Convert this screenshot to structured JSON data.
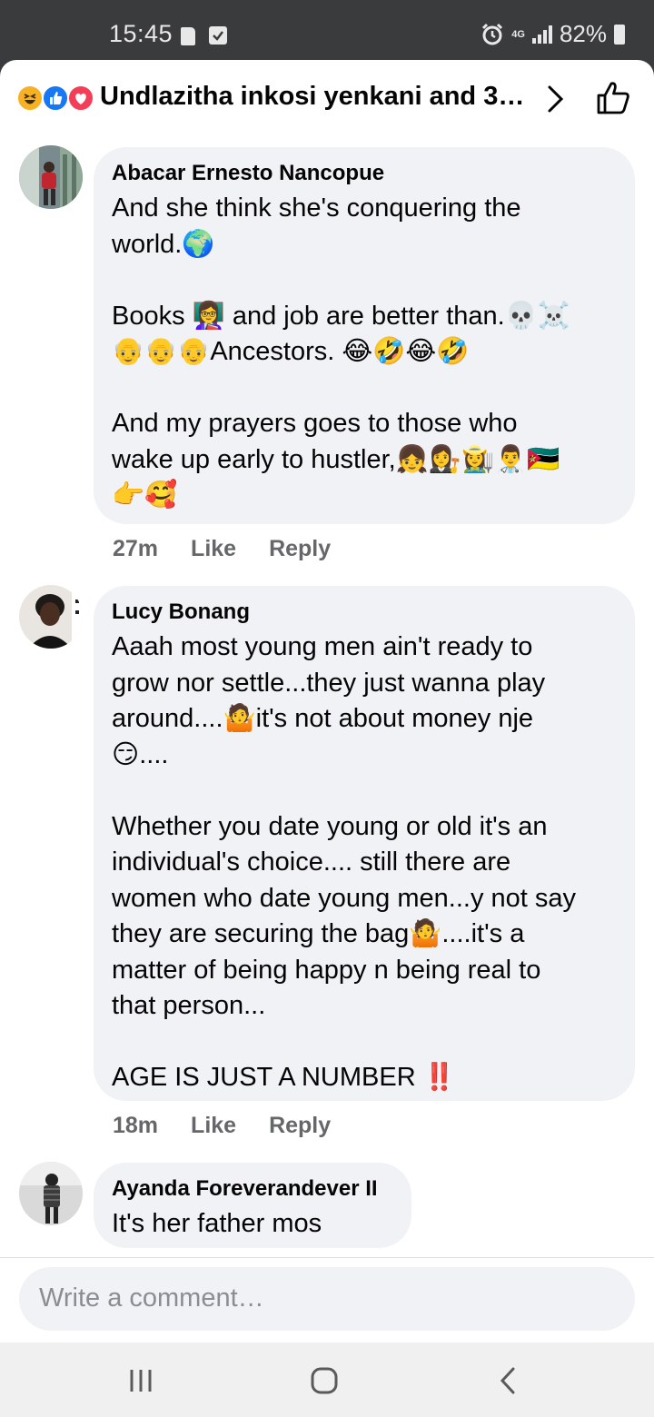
{
  "status_bar": {
    "time": "15:45",
    "network": "4G",
    "battery": "82%"
  },
  "header": {
    "title": "Undlazitha inkosi yenkani and 3…",
    "reactions": [
      "haha",
      "like",
      "love"
    ]
  },
  "comments": [
    {
      "author": "Abacar Ernesto Nancopue",
      "body": "And she think she's conquering the\nworld.🌍\n\nBooks 👩‍🏫 and job are better than.💀☠️\n👴👴👴Ancestors. 😂🤣😂🤣\n\nAnd my prayers goes to those who\nwake up early to hustler,👧👩‍⚖️👩‍🌾👨‍⚕️🇲🇿\n👉🥰",
      "time": "27m",
      "like_label": "Like",
      "reply_label": "Reply"
    },
    {
      "author": "Lucy Bonang",
      "body": "Aaah most young men ain't ready to\ngrow nor settle...they just wanna play\naround....🤷it's not about money nje\n😏....\n\nWhether you date young or old it's an\nindividual's choice.... still there are\nwomen who date young men...y not say\nthey are securing the bag🤷....it's a\nmatter of being happy n being real to\nthat person...\n\nAGE IS JUST A NUMBER ‼️",
      "time": "18m",
      "like_label": "Like",
      "reply_label": "Reply"
    },
    {
      "author": "Ayanda Foreverandever II",
      "body": "It's her father mos"
    }
  ],
  "composer": {
    "placeholder": "Write a comment…"
  },
  "colors": {
    "bubble": "#f0f2f5",
    "meta_text": "#65676b",
    "like_blue": "#1877f2",
    "status_bar_bg": "#3a3b3c"
  }
}
